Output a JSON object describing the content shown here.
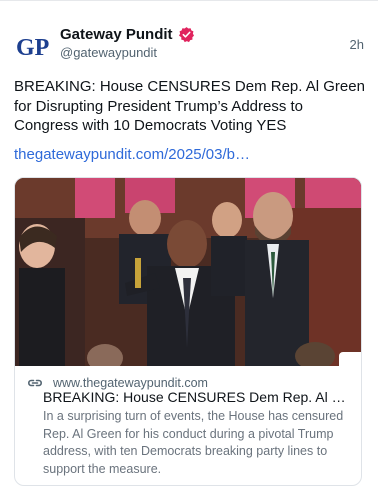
{
  "post": {
    "author_name": "Gateway Pundit",
    "author_handle": "@gatewaypundit",
    "time": "2h",
    "text": "BREAKING: House CENSURES Dem Rep. Al Green for Disrupting President Trump’s Address to Congress with 10 Democrats Voting YES",
    "link": "thegatewaypundit.com/2025/03/b…",
    "avatar_text": "GP",
    "verified_color": "#e0245e"
  },
  "card": {
    "domain": "www.thegatewaypundit.com",
    "title": "BREAKING: House CENSURES Dem Rep. Al Gre…",
    "description": "In a surprising turn of events, the House has censured Rep. Al Green for his conduct during a pivotal Trump address, with ten Democrats breaking party lines to support the measure."
  },
  "colors": {
    "link": "#2f6ad9",
    "avatar_blue": "#1d3f8f"
  }
}
